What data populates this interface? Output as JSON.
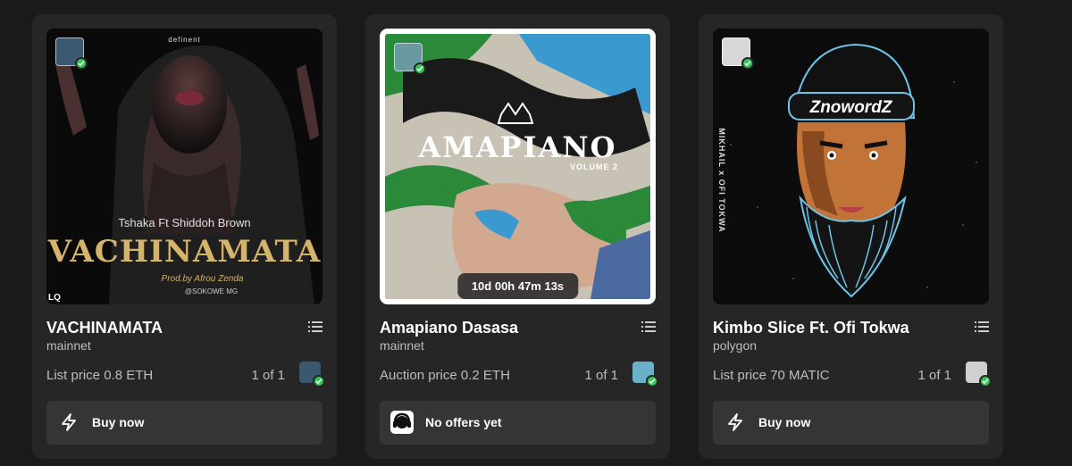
{
  "cards": [
    {
      "title": "VACHINAMATA",
      "network": "mainnet",
      "price": "List price 0.8 ETH",
      "edition": "1 of 1",
      "action": "Buy now",
      "action_icon": "lightning-icon",
      "art": {
        "logo": "definent",
        "credit": "Tshaka Ft Shiddoh Brown",
        "headline": "VACHINAMATA",
        "producer": "Prod.by Afrou Zenda",
        "handle": "@SOKOWE MG",
        "corner": "LQ"
      }
    },
    {
      "title": "Amapiano Dasasa",
      "network": "mainnet",
      "price": "Auction price 0.2 ETH",
      "edition": "1 of 1",
      "action": "No offers yet",
      "action_icon": "headphones-avatar-icon",
      "timer": "10d 00h 47m 13s",
      "art": {
        "headline": "AMAPIANO",
        "subtitle": "VOLUME 2"
      }
    },
    {
      "title": "Kimbo Slice Ft. Ofi Tokwa",
      "network": "polygon",
      "price": "List price 70 MATIC",
      "edition": "1 of 1",
      "action": "Buy now",
      "action_icon": "lightning-icon",
      "art": {
        "headline": "ZnowordZ",
        "side_text": "MIKHAIL x OFI TOKWA"
      }
    }
  ],
  "colors": {
    "background": "#1a1a1a",
    "card": "#262626",
    "button": "#353535",
    "verified": "#34c759",
    "muted_text": "#bdbdbd",
    "gold": "#d4b36a",
    "cyan": "#6fc3e6"
  }
}
